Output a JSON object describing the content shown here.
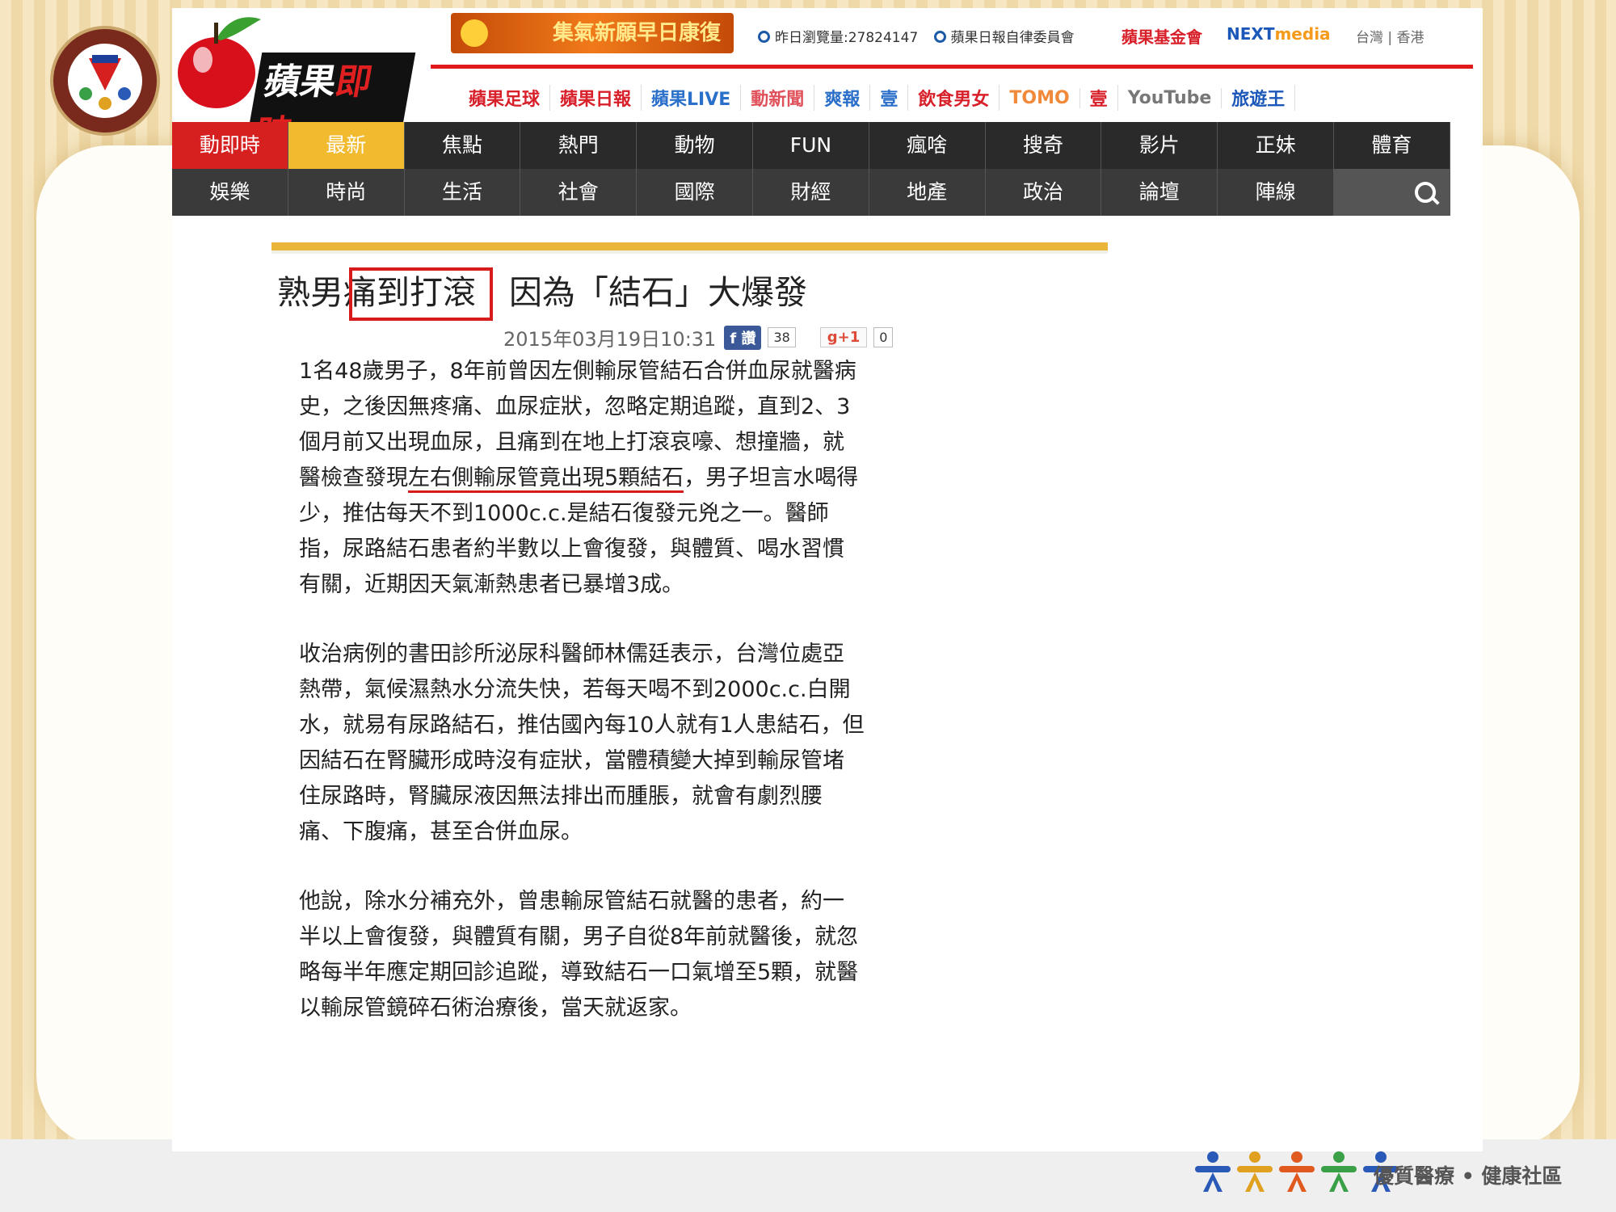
{
  "header": {
    "logo_text_a": "蘋果",
    "logo_text_b": "即時",
    "banner_text": "集氣新願早日康復",
    "views_label": "昨日瀏覽量:27824147",
    "committee_label": "蘋果日報自律委員會",
    "fund_label": "蘋果基金會",
    "nextmedia_a": "NEXT",
    "nextmedia_b": "media",
    "region_tw": "台灣",
    "region_sep": "|",
    "region_hk": "香港"
  },
  "sublinks": [
    {
      "label": "蘋果足球",
      "color": "#d8202a"
    },
    {
      "label": "蘋果日報",
      "color": "#d8202a"
    },
    {
      "label": "蘋果LIVE",
      "color": "#2a6fc9"
    },
    {
      "label": "動新聞",
      "color": "#e0505a"
    },
    {
      "label": "爽報",
      "color": "#2a6fc9"
    },
    {
      "label": "壹",
      "color": "#2a6fc9"
    },
    {
      "label": "飲食男女",
      "color": "#d8202a"
    },
    {
      "label": "TOMO",
      "color": "#f08a3a"
    },
    {
      "label": "壹",
      "color": "#d8202a"
    },
    {
      "label": "YouTube",
      "color": "#777777"
    },
    {
      "label": "旅遊王",
      "color": "#1a57b8"
    }
  ],
  "nav_row1": [
    "動即時",
    "最新",
    "焦點",
    "熱門",
    "動物",
    "FUN",
    "瘋啥",
    "搜奇",
    "影片",
    "正妹",
    "體育"
  ],
  "nav_row2": [
    "娛樂",
    "時尚",
    "生活",
    "社會",
    "國際",
    "財經",
    "地產",
    "政治",
    "論壇",
    "陣線"
  ],
  "colors": {
    "nav_active": "#d61f1f",
    "nav_highlight": "#f2ba2f",
    "accent_gold": "#e9b53a",
    "brand_red": "#e01a1a"
  },
  "article": {
    "title_prefix": "熟男",
    "title_highlight": "痛到打滾",
    "title_suffix": "　因為「結石」大爆發",
    "date": "2015年03月19日10:31",
    "fb_label": "讚",
    "fb_count": "38",
    "gplus_label": "g+1",
    "gplus_count": "0",
    "p1_a": "1名48歲男子，8年前曾因左側輸尿管結石合併血尿就醫病史，之後因無疼痛、血尿症狀，忽略定期追蹤，直到2、3個月前又出現血尿，且痛到在地上打滾哀嚎、想撞牆，就醫檢查發現",
    "p1_underline": "左右側輸尿管竟出現5顆結石",
    "p1_b": "，男子坦言水喝得少，推估每天不到1000c.c.是結石復發元兇之一。醫師指，尿路結石患者約半數以上會復發，與體質、喝水習慣有關，近期因天氣漸熱患者已暴增3成。",
    "p2": "收治病例的書田診所泌尿科醫師林儒廷表示，台灣位處亞熱帶，氣候濕熱水分流失快，若每天喝不到2000c.c.白開水，就易有尿路結石，推估國內每10人就有1人患結石，但因結石在腎臟形成時沒有症狀，當體積變大掉到輸尿管堵住尿路時，腎臟尿液因無法排出而腫脹，就會有劇烈腰痛、下腹痛，甚至合併血尿。",
    "p3": "他說，除水分補充外，曾患輸尿管結石就醫的患者，約一半以上會復發，與體質有關，男子自從8年前就醫後，就忽略每半年應定期回診追蹤，導致結石一口氣增至5顆，就醫以輸尿管鏡碎石術治療後，當天就返家。"
  },
  "footer": {
    "slogan": "優質醫療 • 健康社區",
    "figure_colors": [
      "#2a5ab8",
      "#e0a020",
      "#e05a20",
      "#3aa048",
      "#2a5ab8"
    ]
  }
}
